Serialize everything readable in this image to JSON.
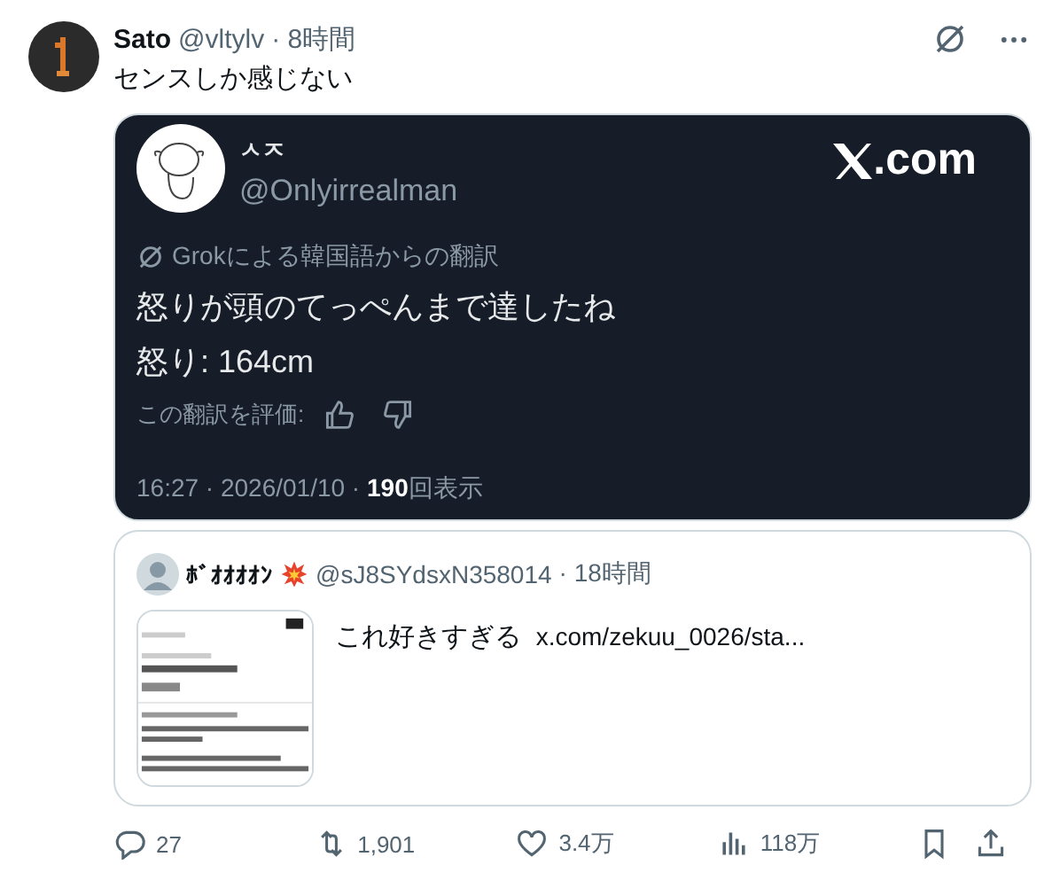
{
  "post": {
    "name": "Sato",
    "handle": "@vltylv",
    "time": "· 8時間",
    "text": "センスしか感じない"
  },
  "image": {
    "name": "ㅅㅈ",
    "handle": "@Onlyirrealman",
    "logo_text": ".com",
    "translation_label": "Grokによる韓国語からの翻訳",
    "lines": [
      "怒りが頭のてっぺんまで達したね",
      "怒り: 164cm"
    ],
    "rate_label": "この翻訳を評価:",
    "timestamp": "16:27 · 2026/01/10 · ",
    "views": "190",
    "views_label": "回表示"
  },
  "quote": {
    "name": "ﾎﾞｵｵｵｵﾝ",
    "handle": "@sJ8SYdsxN358014",
    "time": "· 18時間",
    "text": "これ好きすぎる",
    "link": "x.com/zekuu_0026/sta..."
  },
  "actions": [
    {
      "kind": "reply",
      "count": "27"
    },
    {
      "kind": "repost",
      "count": "1,901"
    },
    {
      "kind": "like",
      "count": "3.4万"
    },
    {
      "kind": "views",
      "count": "118万"
    },
    {
      "kind": "bookmark"
    },
    {
      "kind": "share"
    }
  ]
}
